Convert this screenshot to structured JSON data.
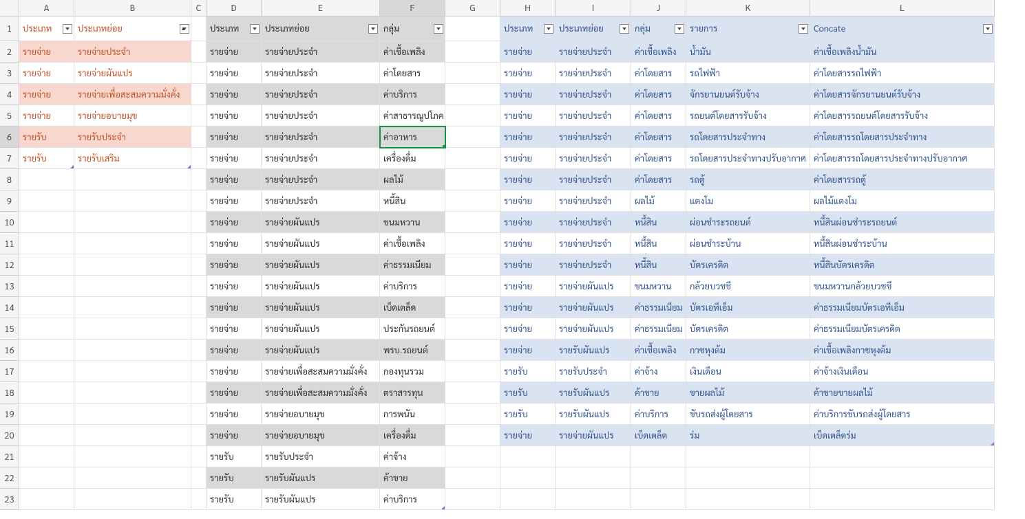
{
  "columns": [
    "A",
    "B",
    "C",
    "D",
    "E",
    "F",
    "G",
    "H",
    "I",
    "J",
    "K",
    "L"
  ],
  "row_count": 23,
  "active_cell": {
    "row": 6,
    "col": "F"
  },
  "tableAB": {
    "headers": {
      "A": "ประเภท",
      "B": "ประเภทย่อย"
    },
    "rows": [
      {
        "A": "รายจ่าย",
        "B": "รายจ่ายประจำ"
      },
      {
        "A": "รายจ่าย",
        "B": "รายจ่ายผันแปร"
      },
      {
        "A": "รายจ่าย",
        "B": "รายจ่ายเพื่อสะสมความมั่งคั่ง"
      },
      {
        "A": "รายจ่าย",
        "B": "รายจ่ายอบายมุข"
      },
      {
        "A": "รายรับ",
        "B": "รายรับประจำ"
      },
      {
        "A": "รายรับ",
        "B": "รายรับเสริม"
      }
    ]
  },
  "tableDEF": {
    "headers": {
      "D": "ประเภท",
      "E": "ประเภทย่อย",
      "F": "กลุ่ม"
    },
    "rows": [
      {
        "D": "รายจ่าย",
        "E": "รายจ่ายประจำ",
        "F": "ค่าเชื้อเพลิง"
      },
      {
        "D": "รายจ่าย",
        "E": "รายจ่ายประจำ",
        "F": "ค่าโดยสาร"
      },
      {
        "D": "รายจ่าย",
        "E": "รายจ่ายประจำ",
        "F": "ค่าบริการ"
      },
      {
        "D": "รายจ่าย",
        "E": "รายจ่ายประจำ",
        "F": "ค่าสาธารณูปโภค"
      },
      {
        "D": "รายจ่าย",
        "E": "รายจ่ายประจำ",
        "F": "ค่าอาหาร"
      },
      {
        "D": "รายจ่าย",
        "E": "รายจ่ายประจำ",
        "F": "เครื่องดื่ม"
      },
      {
        "D": "รายจ่าย",
        "E": "รายจ่ายประจำ",
        "F": "ผลไม้"
      },
      {
        "D": "รายจ่าย",
        "E": "รายจ่ายประจำ",
        "F": "หนี้สิน"
      },
      {
        "D": "รายจ่าย",
        "E": "รายจ่ายผันแปร",
        "F": "ขนมหวาน"
      },
      {
        "D": "รายจ่าย",
        "E": "รายจ่ายผันแปร",
        "F": "ค่าเชื้อเพลิง"
      },
      {
        "D": "รายจ่าย",
        "E": "รายจ่ายผันแปร",
        "F": "ค่าธรรมเนียม"
      },
      {
        "D": "รายจ่าย",
        "E": "รายจ่ายผันแปร",
        "F": "ค่าบริการ"
      },
      {
        "D": "รายจ่าย",
        "E": "รายจ่ายผันแปร",
        "F": "เบ็ดเตล็ด"
      },
      {
        "D": "รายจ่าย",
        "E": "รายจ่ายผันแปร",
        "F": "ประกันรถยนต์"
      },
      {
        "D": "รายจ่าย",
        "E": "รายจ่ายผันแปร",
        "F": "พรบ.รถยนต์"
      },
      {
        "D": "รายจ่าย",
        "E": "รายจ่ายเพื่อสะสมความมั่งคั่ง",
        "F": "กองทุนรวม"
      },
      {
        "D": "รายจ่าย",
        "E": "รายจ่ายเพื่อสะสมความมั่งคั่ง",
        "F": "ตราสารทุน"
      },
      {
        "D": "รายจ่าย",
        "E": "รายจ่ายอบายมุข",
        "F": "การพนัน"
      },
      {
        "D": "รายจ่าย",
        "E": "รายจ่ายอบายมุข",
        "F": "เครื่องดื่ม"
      },
      {
        "D": "รายรับ",
        "E": "รายรับประจำ",
        "F": "ค่าจ้าง"
      },
      {
        "D": "รายรับ",
        "E": "รายรับผันแปร",
        "F": "ค้าขาย"
      },
      {
        "D": "รายรับ",
        "E": "รายรับผันแปร",
        "F": "ค่าบริการ"
      }
    ]
  },
  "tableHL": {
    "headers": {
      "H": "ประเภท",
      "I": "ประเภทย่อย",
      "J": "กลุ่ม",
      "K": "รายการ",
      "L": "Concate"
    },
    "rows": [
      {
        "H": "รายจ่าย",
        "I": "รายจ่ายประจำ",
        "J": "ค่าเชื้อเพลิง",
        "K": "น้ำมัน",
        "L": "ค่าเชื้อเพลิงน้ำมัน"
      },
      {
        "H": "รายจ่าย",
        "I": "รายจ่ายประจำ",
        "J": "ค่าโดยสาร",
        "K": "รถไฟฟ้า",
        "L": "ค่าโดยสารรถไฟฟ้า"
      },
      {
        "H": "รายจ่าย",
        "I": "รายจ่ายประจำ",
        "J": "ค่าโดยสาร",
        "K": "จักรยานยนต์รับจ้าง",
        "L": "ค่าโดยสารจักรยานยนต์รับจ้าง"
      },
      {
        "H": "รายจ่าย",
        "I": "รายจ่ายประจำ",
        "J": "ค่าโดยสาร",
        "K": "รถยนต์โดยสารรับจ้าง",
        "L": "ค่าโดยสารรถยนต์โดยสารรับจ้าง"
      },
      {
        "H": "รายจ่าย",
        "I": "รายจ่ายประจำ",
        "J": "ค่าโดยสาร",
        "K": "รถโดยสารประจำทาง",
        "L": "ค่าโดยสารรถโดยสารประจำทาง"
      },
      {
        "H": "รายจ่าย",
        "I": "รายจ่ายประจำ",
        "J": "ค่าโดยสาร",
        "K": "รถโดยสารประจำทางปรับอากาศ",
        "L": "ค่าโดยสารรถโดยสารประจำทางปรับอากาศ"
      },
      {
        "H": "รายจ่าย",
        "I": "รายจ่ายประจำ",
        "J": "ค่าโดยสาร",
        "K": "รถตู้",
        "L": "ค่าโดยสารรถตู้"
      },
      {
        "H": "รายจ่าย",
        "I": "รายจ่ายประจำ",
        "J": "ผลไม้",
        "K": "แตงโม",
        "L": "ผลไม้แตงโม"
      },
      {
        "H": "รายจ่าย",
        "I": "รายจ่ายประจำ",
        "J": "หนี้สิน",
        "K": "ผ่อนชำระรถยนต์",
        "L": "หนี้สินผ่อนชำระรถยนต์"
      },
      {
        "H": "รายจ่าย",
        "I": "รายจ่ายประจำ",
        "J": "หนี้สิน",
        "K": "ผ่อนชำระบ้าน",
        "L": "หนี้สินผ่อนชำระบ้าน"
      },
      {
        "H": "รายจ่าย",
        "I": "รายจ่ายประจำ",
        "J": "หนี้สิน",
        "K": "บัตรเครดิต",
        "L": "หนี้สินบัตรเครดิต"
      },
      {
        "H": "รายจ่าย",
        "I": "รายจ่ายผันแปร",
        "J": "ขนมหวาน",
        "K": "กล้วยบวชชี",
        "L": "ขนมหวานกล้วยบวชชี"
      },
      {
        "H": "รายจ่าย",
        "I": "รายจ่ายผันแปร",
        "J": "ค่าธรรมเนียม",
        "K": "บัตรเอทีเอ็ม",
        "L": "ค่าธรรมเนียมบัตรเอทีเอ็ม"
      },
      {
        "H": "รายจ่าย",
        "I": "รายจ่ายผันแปร",
        "J": "ค่าธรรมเนียม",
        "K": "บัตรเครดิต",
        "L": "ค่าธรรมเนียมบัตรเครดิต"
      },
      {
        "H": "รายจ่าย",
        "I": "รายรับผันแปร",
        "J": "ค่าเชื้อเพลิง",
        "K": "กาซหุงต้ม",
        "L": "ค่าเชื้อเพลิงกาซหุงต้ม"
      },
      {
        "H": "รายรับ",
        "I": "รายรับประจำ",
        "J": "ค่าจ้าง",
        "K": "เงินเดือน",
        "L": "ค่าจ้างเงินเดือน"
      },
      {
        "H": "รายรับ",
        "I": "รายรับผันแปร",
        "J": "ค้าขาย",
        "K": "ขายผลไม้",
        "L": "ค้าขายขายผลไม้"
      },
      {
        "H": "รายรับ",
        "I": "รายรับผันแปร",
        "J": "ค่าบริการ",
        "K": "ขับรถส่งผู้โดยสาร",
        "L": "ค่าบริการขับรถส่งผู้โดยสาร"
      },
      {
        "H": "รายจ่าย",
        "I": "รายจ่ายผันแปร",
        "J": "เบ็ดเตล็ด",
        "K": "ร่ม",
        "L": "เบ็ดเตล็ดร่ม"
      }
    ]
  }
}
